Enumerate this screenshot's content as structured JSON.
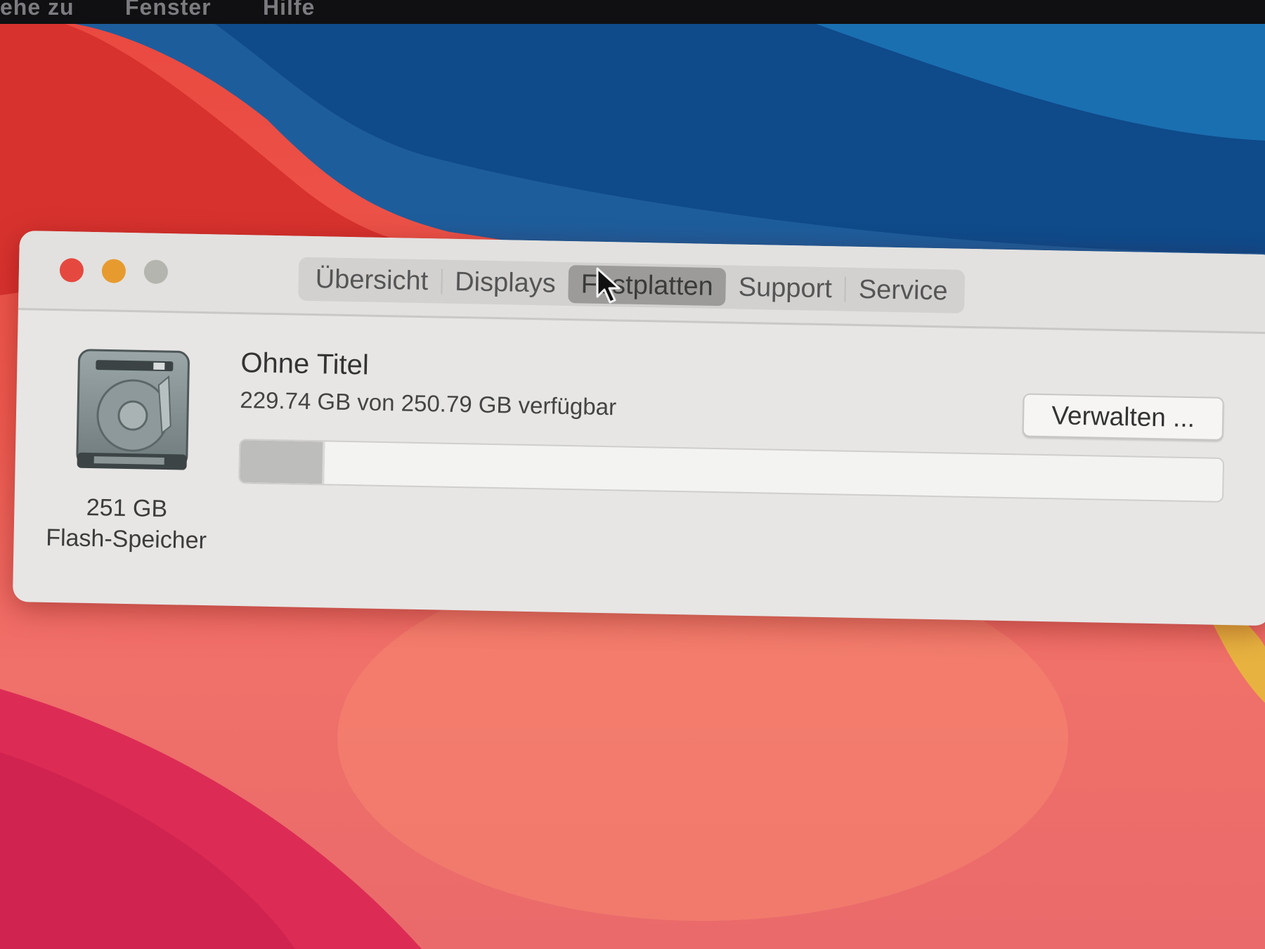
{
  "menubar": {
    "items": [
      "ehe zu",
      "Fenster",
      "Hilfe"
    ]
  },
  "window": {
    "tabs": [
      {
        "label": "Übersicht",
        "selected": false
      },
      {
        "label": "Displays",
        "selected": false
      },
      {
        "label": "Festplatten",
        "selected": true
      },
      {
        "label": "Support",
        "selected": false
      },
      {
        "label": "Service",
        "selected": false
      }
    ],
    "disk": {
      "icon": "hard-disk-icon",
      "size": "251 GB",
      "type": "Flash-Speicher"
    },
    "volume": {
      "name": "Ohne Titel",
      "availability": "229.74 GB von 250.79 GB verfügbar",
      "used_fraction": 0.084
    },
    "manage_button": "Verwalten ..."
  },
  "colors": {
    "close": "#e5483f",
    "minimize": "#e79b2e",
    "zoom": "#b3b5ae",
    "selected_tab": "#9c9b99"
  }
}
